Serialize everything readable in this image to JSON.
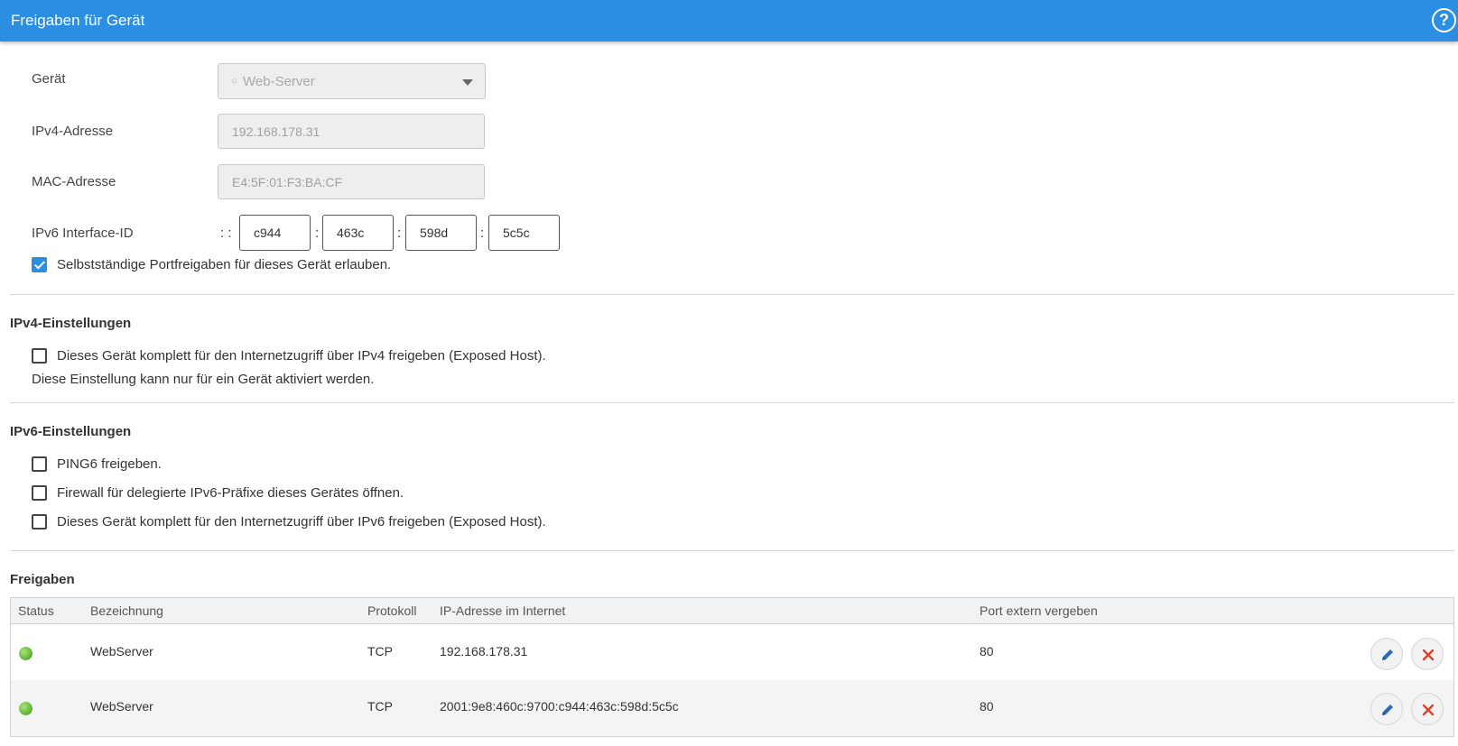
{
  "header": {
    "title": "Freigaben für Gerät",
    "help": "?"
  },
  "device": {
    "label": "Gerät",
    "value": "Web-Server",
    "prefix": "○"
  },
  "ipv4": {
    "label": "IPv4-Adresse",
    "value": "192.168.178.31"
  },
  "mac": {
    "label": "MAC-Adresse",
    "value": "E4:5F:01:F3:BA:CF"
  },
  "ipv6_id": {
    "label": "IPv6 Interface-ID",
    "prefix": ": :",
    "separator": ":",
    "parts": [
      "c944",
      "463c",
      "598d",
      "5c5c"
    ]
  },
  "self_port": {
    "label": "Selbstständige Portfreigaben für dieses Gerät erlauben.",
    "checked": true
  },
  "ipv4_settings": {
    "title": "IPv4-Einstellungen",
    "exposed_host_label": "Dieses Gerät komplett für den Internetzugriff über IPv4 freigeben (Exposed Host).",
    "note": "Diese Einstellung kann nur für ein Gerät aktiviert werden."
  },
  "ipv6_settings": {
    "title": "IPv6-Einstellungen",
    "options": [
      "PING6 freigeben.",
      "Firewall für delegierte IPv6-Präfixe dieses Gerätes öffnen.",
      "Dieses Gerät komplett für den Internetzugriff über IPv6 freigeben (Exposed Host)."
    ]
  },
  "shares": {
    "title": "Freigaben",
    "columns": [
      "Status",
      "Bezeichnung",
      "Protokoll",
      "IP-Adresse im Internet",
      "Port extern vergeben"
    ],
    "rows": [
      {
        "status": "active",
        "name": "WebServer",
        "protocol": "TCP",
        "ip": "192.168.178.31",
        "port": "80"
      },
      {
        "status": "active",
        "name": "WebServer",
        "protocol": "TCP",
        "ip": "2001:9e8:460c:9700:c944:463c:598d:5c5c",
        "port": "80"
      }
    ]
  },
  "icons": {
    "edit": "pencil-icon",
    "delete": "close-icon",
    "status": "green-status-dot"
  },
  "colors": {
    "accent": "#2b8ee0",
    "edit_icon": "#2b6cb8",
    "delete_icon": "#e0412c",
    "status_ok": "#5ab22e"
  }
}
